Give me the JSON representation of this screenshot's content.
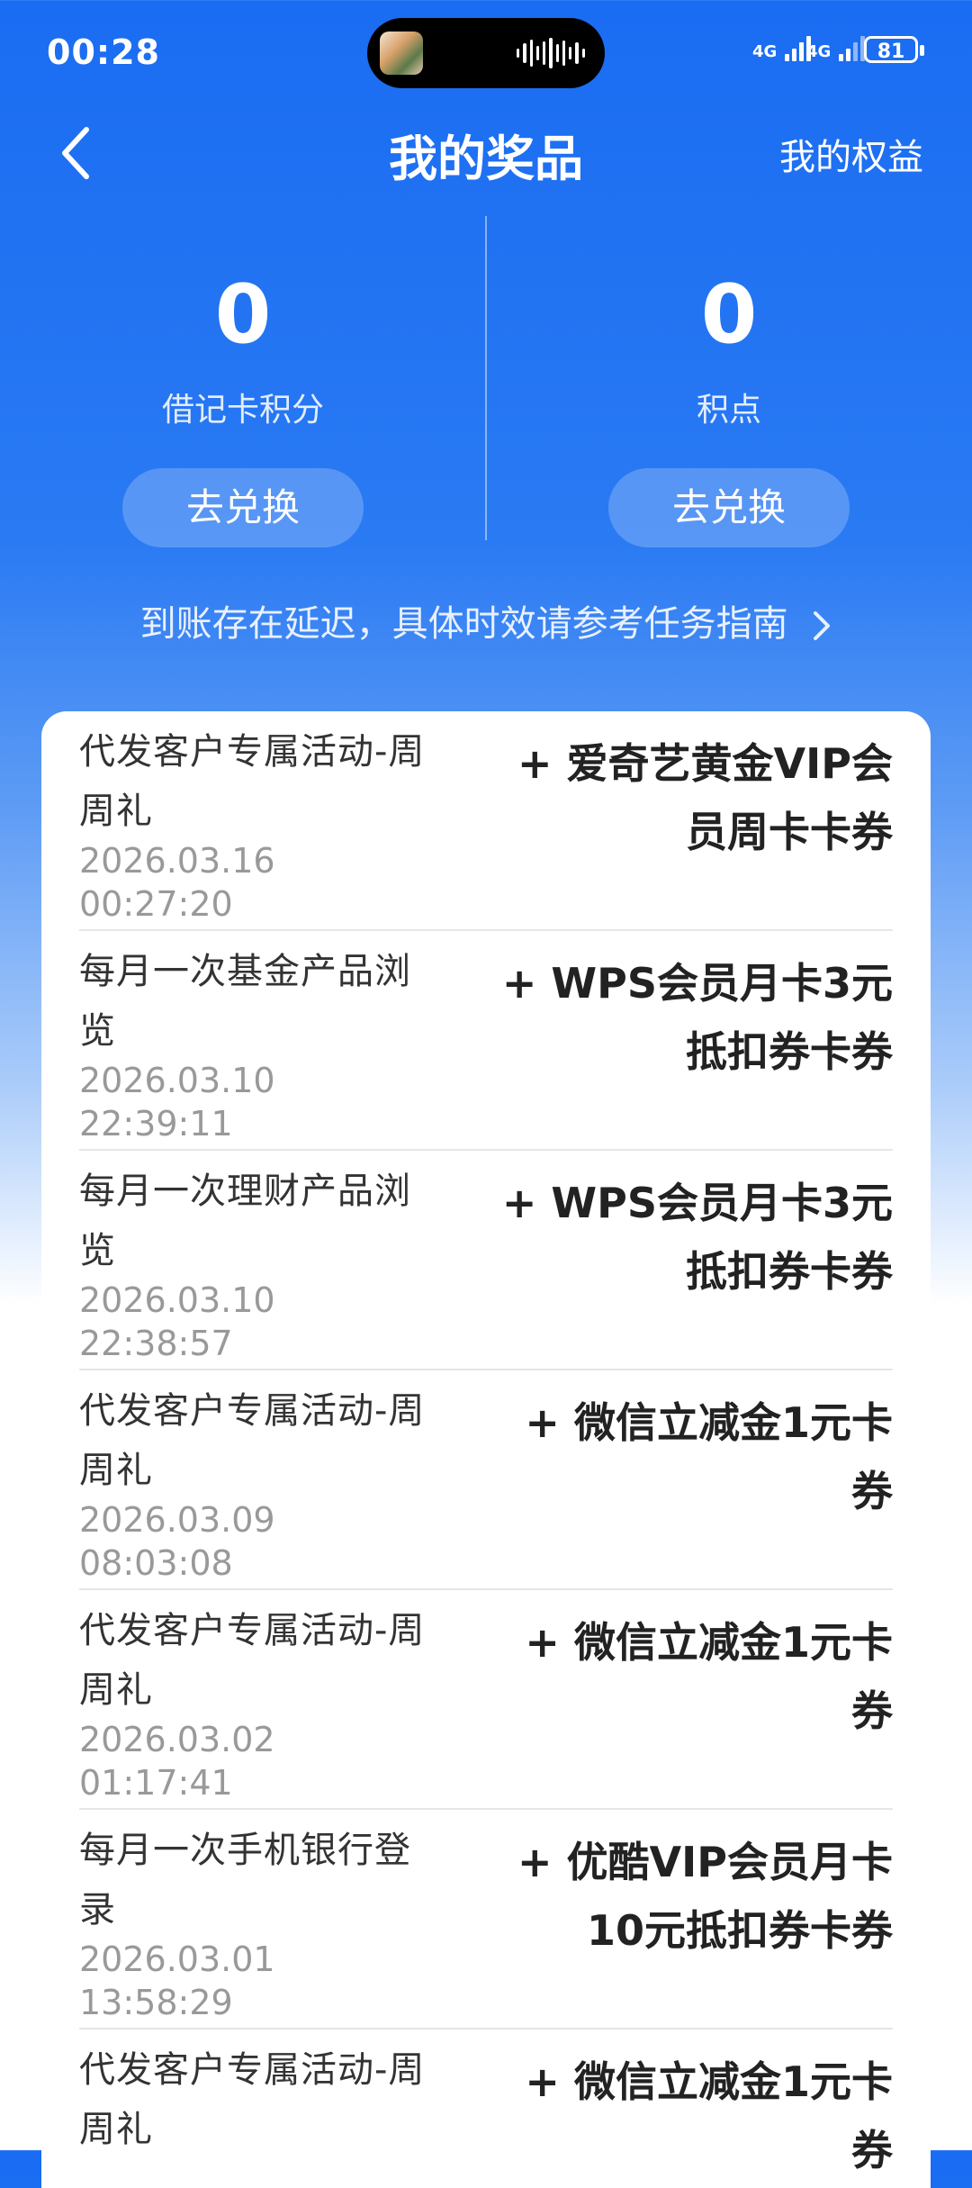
{
  "status_bar": {
    "time": "00:28",
    "signal1_label": "4G",
    "signal2_label": "4G",
    "battery": "81"
  },
  "nav": {
    "title": "我的奖品",
    "right_label": "我的权益"
  },
  "points": [
    {
      "value": "0",
      "label": "借记卡积分",
      "button": "去兑换"
    },
    {
      "value": "0",
      "label": "积点",
      "button": "去兑换"
    }
  ],
  "notice": "到账存在延迟，具体时效请参考任务指南",
  "rewards": [
    {
      "title": "代发客户专属活动-周周礼",
      "date": "2026.03.16 00:27:20",
      "reward": "+ 爱奇艺黄金VIP会员周卡卡券"
    },
    {
      "title": "每月一次基金产品浏览",
      "date": "2026.03.10 22:39:11",
      "reward": "+ WPS会员月卡3元抵扣券卡券"
    },
    {
      "title": "每月一次理财产品浏览",
      "date": "2026.03.10 22:38:57",
      "reward": "+ WPS会员月卡3元抵扣券卡券"
    },
    {
      "title": "代发客户专属活动-周周礼",
      "date": "2026.03.09 08:03:08",
      "reward": "+ 微信立减金1元卡券"
    },
    {
      "title": "代发客户专属活动-周周礼",
      "date": "2026.03.02 01:17:41",
      "reward": "+ 微信立减金1元卡券"
    },
    {
      "title": "每月一次手机银行登录",
      "date": "2026.03.01 13:58:29",
      "reward": "+ 优酷VIP会员月卡10元抵扣券卡券"
    },
    {
      "title": "代发客户专属活动-周周礼",
      "date": "",
      "reward": "+ 微信立减金1元卡券"
    }
  ]
}
